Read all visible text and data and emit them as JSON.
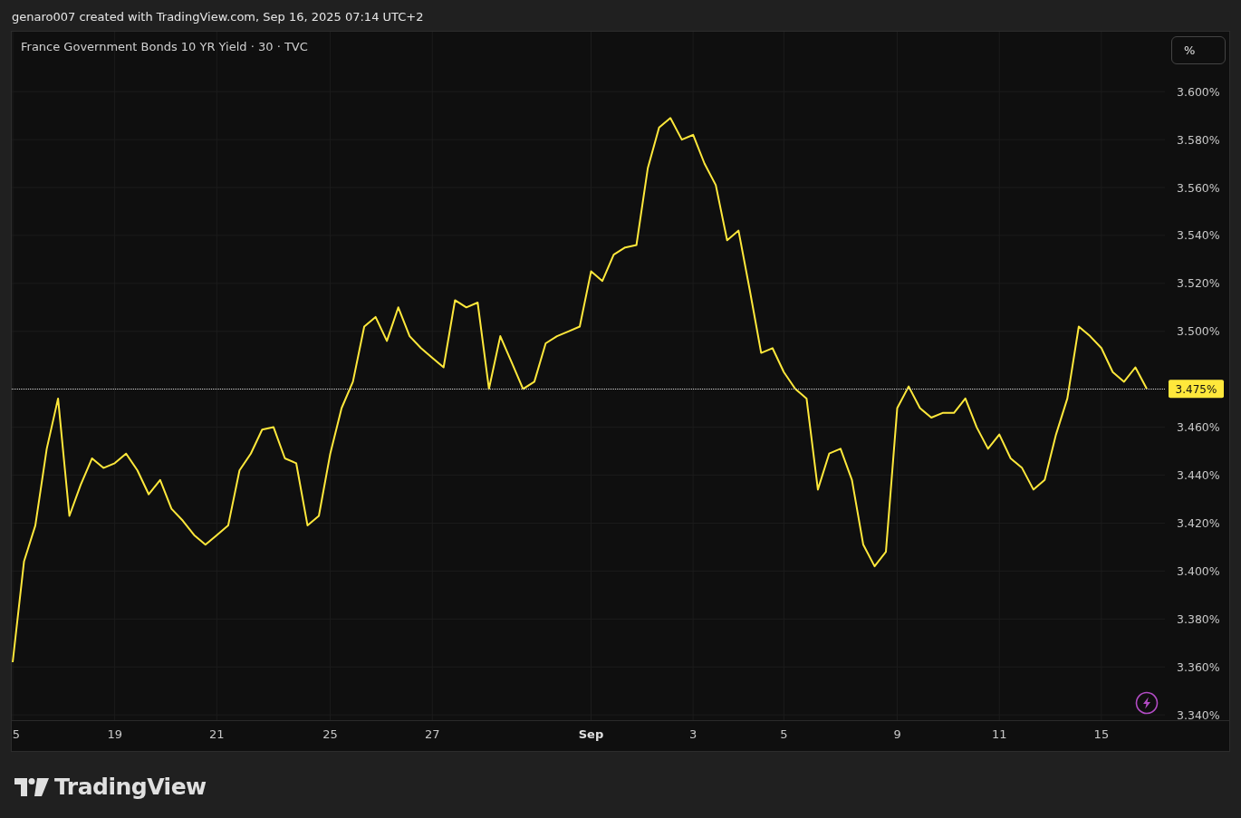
{
  "caption": "genaro007 created with TradingView.com, Sep 16, 2025 07:14 UTC+2",
  "chart": {
    "title": "France Government Bonds 10 YR Yield · 30 · TVC",
    "unit_button": "%",
    "last_price": "3.475%",
    "chart_data": {
      "type": "line",
      "categories": [
        "5",
        null,
        null,
        null,
        null,
        null,
        null,
        null,
        null,
        "19",
        null,
        null,
        null,
        null,
        null,
        null,
        null,
        null,
        "21",
        null,
        null,
        null,
        null,
        null,
        null,
        null,
        null,
        null,
        "25",
        null,
        null,
        null,
        null,
        null,
        null,
        null,
        null,
        "27",
        null,
        null,
        null,
        null,
        null,
        null,
        null,
        null,
        null,
        null,
        null,
        null,
        null,
        "Sep",
        null,
        null,
        null,
        null,
        null,
        null,
        null,
        null,
        "3",
        null,
        null,
        null,
        null,
        null,
        null,
        null,
        "5",
        null,
        null,
        null,
        null,
        null,
        null,
        null,
        null,
        null,
        "9",
        null,
        null,
        null,
        null,
        null,
        null,
        null,
        null,
        "11",
        null,
        null,
        null,
        null,
        null,
        null,
        null,
        null,
        "15",
        null,
        null,
        null,
        null
      ],
      "series": [
        {
          "color": "#ffe83b",
          "values": [
            3.362,
            3.404,
            3.419,
            3.451,
            3.472,
            3.423,
            3.436,
            3.447,
            3.443,
            3.445,
            3.449,
            3.442,
            3.432,
            3.438,
            3.426,
            3.421,
            3.415,
            3.411,
            3.415,
            3.419,
            3.442,
            3.449,
            3.459,
            3.46,
            3.447,
            3.445,
            3.419,
            3.423,
            3.449,
            3.468,
            3.479,
            3.502,
            3.506,
            3.496,
            3.51,
            3.498,
            3.493,
            3.489,
            3.485,
            3.513,
            3.51,
            3.512,
            3.476,
            3.498,
            3.487,
            3.476,
            3.479,
            3.495,
            3.498,
            3.5,
            3.502,
            3.525,
            3.521,
            3.532,
            3.535,
            3.536,
            3.568,
            3.585,
            3.589,
            3.58,
            3.582,
            3.57,
            3.561,
            3.538,
            3.542,
            3.517,
            3.491,
            3.493,
            3.483,
            3.476,
            3.472,
            3.434,
            3.449,
            3.451,
            3.438,
            3.411,
            3.402,
            3.408,
            3.468,
            3.477,
            3.468,
            3.464,
            3.466,
            3.466,
            3.472,
            3.46,
            3.451,
            3.457,
            3.447,
            3.443,
            3.434,
            3.438,
            3.457,
            3.472,
            3.502,
            3.498,
            3.493,
            3.483,
            3.479,
            3.485,
            3.476
          ]
        }
      ],
      "ylim": [
        3.3378,
        3.625
      ],
      "grid": true,
      "yticks": [
        {
          "value": 3.34,
          "label": "3.340%"
        },
        {
          "value": 3.36,
          "label": "3.360%"
        },
        {
          "value": 3.38,
          "label": "3.380%"
        },
        {
          "value": 3.4,
          "label": "3.400%"
        },
        {
          "value": 3.42,
          "label": "3.420%"
        },
        {
          "value": 3.44,
          "label": "3.440%"
        },
        {
          "value": 3.46,
          "label": "3.460%"
        },
        {
          "value": 3.5,
          "label": "3.500%"
        },
        {
          "value": 3.52,
          "label": "3.520%"
        },
        {
          "value": 3.54,
          "label": "3.540%"
        },
        {
          "value": 3.56,
          "label": "3.560%"
        },
        {
          "value": 3.58,
          "label": "3.580%"
        },
        {
          "value": 3.6,
          "label": "3.600%"
        }
      ]
    }
  },
  "footer": {
    "brand": "TradingView"
  }
}
